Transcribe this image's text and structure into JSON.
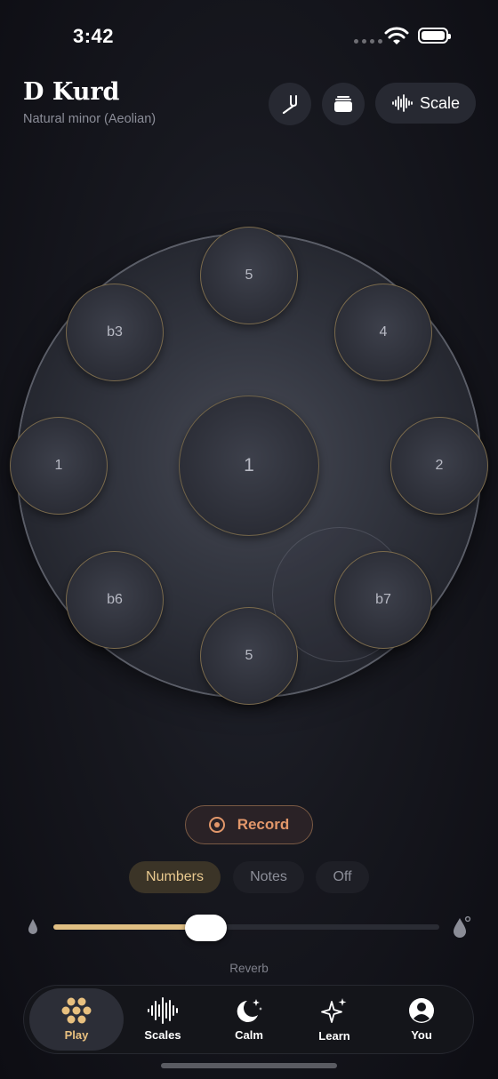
{
  "status_bar": {
    "time": "3:42"
  },
  "header": {
    "title": "D Kurd",
    "subtitle": "Natural minor (Aeolian)",
    "scale_button_label": "Scale"
  },
  "handpan": {
    "center": "1",
    "notes": [
      "5",
      "4",
      "2",
      "b7",
      "5",
      "b6",
      "1",
      "b3"
    ]
  },
  "record_label": "Record",
  "display_mode": {
    "options": [
      "Numbers",
      "Notes",
      "Off"
    ],
    "selected": "Numbers"
  },
  "reverb": {
    "label": "Reverb",
    "value_fraction": 0.39
  },
  "colors": {
    "accent": "#e0bf83",
    "record": "#e2976a",
    "background": "#17181f"
  },
  "tabs": [
    {
      "label": "Play",
      "icon": "flower-dots-icon",
      "active": true
    },
    {
      "label": "Scales",
      "icon": "waveform-icon",
      "active": false
    },
    {
      "label": "Calm",
      "icon": "moon-stars-icon",
      "active": false
    },
    {
      "label": "Learn",
      "icon": "sparkles-icon",
      "active": false
    },
    {
      "label": "You",
      "icon": "person-circle-icon",
      "active": false
    }
  ]
}
